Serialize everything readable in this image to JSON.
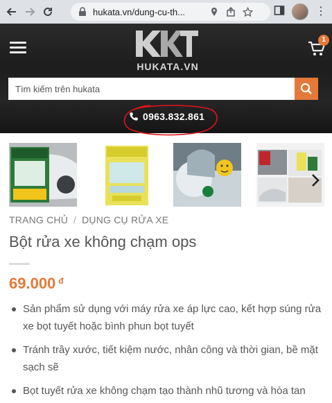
{
  "browser": {
    "url": "hukata.vn/dung-cu-th..."
  },
  "site": {
    "logo_text": "HUKATA.VN",
    "cart_count": "1",
    "search_placeholder": "Tìm kiếm trên hukata",
    "phone": "0963.832.861",
    "accent_color": "#e4793a",
    "annotation_color": "#e0141c"
  },
  "thumbnails": [
    {
      "name": "product-thumb-1"
    },
    {
      "name": "product-thumb-2"
    },
    {
      "name": "product-thumb-3"
    },
    {
      "name": "product-thumb-4"
    }
  ],
  "breadcrumb": {
    "home": "TRANG CHỦ",
    "separator": "/",
    "category": "DỤNG CỤ RỬA XE"
  },
  "product": {
    "title": "Bột rửa xe không chạm ops",
    "price": "69.000",
    "currency": "đ",
    "features": [
      "Sản phẩm sử dụng với máy rửa xe áp lực cao, kết hợp súng rửa xe bọt tuyết hoặc bình phun bọt tuyết",
      "Tránh trầy xước, tiết kiệm nước, nhân công và thời gian, bề mặt sạch sẽ",
      "Bọt tuyết rửa xe không chạm tạo thành nhũ tương và hòa tan"
    ]
  }
}
